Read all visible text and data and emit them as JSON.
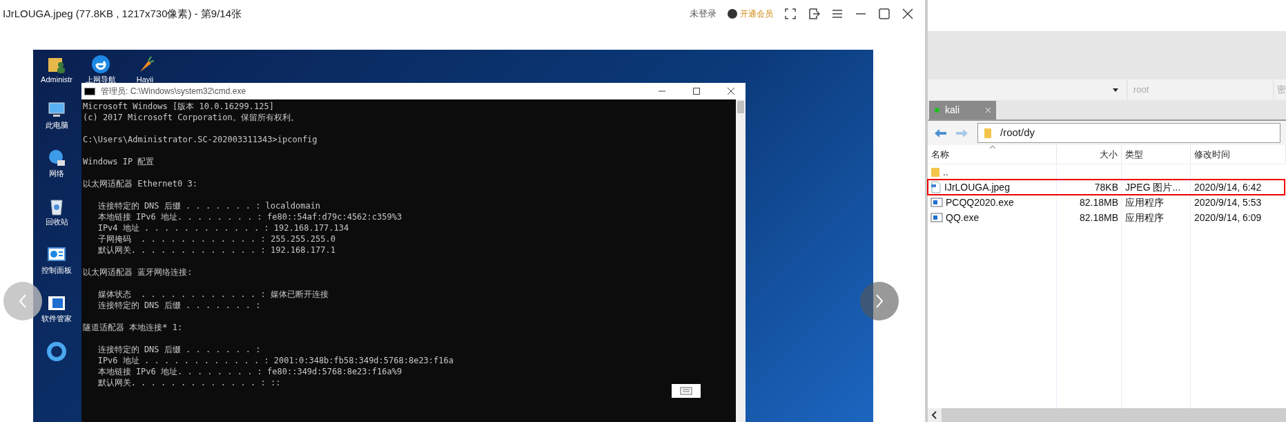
{
  "viewer": {
    "title": "IJrLOUGA.jpeg (77.8KB , 1217x730像素) - 第9/14张",
    "login": "未登录",
    "vip": "开通会员"
  },
  "desktop": {
    "icons": [
      {
        "label": "Administr",
        "kind": "user"
      },
      {
        "label": "上网导航",
        "kind": "browser"
      },
      {
        "label": "Hayii",
        "kind": "carrot"
      },
      {
        "label": "此电脑",
        "kind": "pc"
      },
      {
        "label": "网络",
        "kind": "network"
      },
      {
        "label": "回收站",
        "kind": "recycle"
      },
      {
        "label": "控制面板",
        "kind": "panel"
      },
      {
        "label": "软件管家",
        "kind": "software"
      },
      {
        "kind": "app"
      }
    ],
    "cmd": {
      "title": "管理员: C:\\Windows\\system32\\cmd.exe",
      "blocks": [
        {
          "lines": [
            "Microsoft Windows [版本 10.0.16299.125]",
            "(c) 2017 Microsoft Corporation。保留所有权利。"
          ]
        },
        {
          "lines": [
            "C:\\Users\\Administrator.SC-202003311343>ipconfig"
          ]
        },
        {
          "lines": [
            "Windows IP 配置"
          ]
        },
        {
          "lines": [
            "以太网适配器 Ethernet0 3:"
          ]
        },
        {
          "lines": [
            "   连接特定的 DNS 后缀 . . . . . . . : localdomain",
            "   本地链接 IPv6 地址. . . . . . . . : fe80::54af:d79c:4562:c359%3",
            "   IPv4 地址 . . . . . . . . . . . . : 192.168.177.134",
            "   子网掩码  . . . . . . . . . . . . : 255.255.255.0",
            "   默认网关. . . . . . . . . . . . . : 192.168.177.1"
          ]
        },
        {
          "lines": [
            "以太网适配器 蓝牙网络连接:"
          ]
        },
        {
          "lines": [
            "   媒体状态  . . . . . . . . . . . . : 媒体已断开连接",
            "   连接特定的 DNS 后缀 . . . . . . . :"
          ]
        },
        {
          "lines": [
            "隧道适配器 本地连接* 1:"
          ]
        },
        {
          "lines": [
            "   连接特定的 DNS 后缀 . . . . . . . :",
            "   IPv6 地址 . . . . . . . . . . . . : 2001:0:348b:fb58:349d:5768:8e23:f16a",
            "   本地链接 IPv6 地址. . . . . . . . : fe80::349d:5768:8e23:f16a%9",
            "   默认网关. . . . . . . . . . . . . : ::"
          ]
        }
      ]
    }
  },
  "sftp": {
    "user": "root",
    "password_label": "密",
    "tabs": [
      {
        "label": "kali",
        "selected": true,
        "connected": true
      }
    ],
    "path": "/root/dy",
    "columns": [
      "名称",
      "大小",
      "类型",
      "修改时间"
    ],
    "rows": [
      {
        "name": "..",
        "kind": "folder",
        "marked": false
      },
      {
        "name": "IJrLOUGA.jpeg",
        "kind": "image",
        "size": "78KB",
        "type": "JPEG 图片...",
        "modified": "2020/9/14, 6:42",
        "marked": true
      },
      {
        "name": "PCQQ2020.exe",
        "kind": "exe",
        "size": "82.18MB",
        "type": "应用程序",
        "modified": "2020/9/14, 5:53",
        "marked": false
      },
      {
        "name": "QQ.exe",
        "kind": "exe",
        "size": "82.18MB",
        "type": "应用程序",
        "modified": "2020/9/14, 6:09",
        "marked": false
      }
    ]
  }
}
